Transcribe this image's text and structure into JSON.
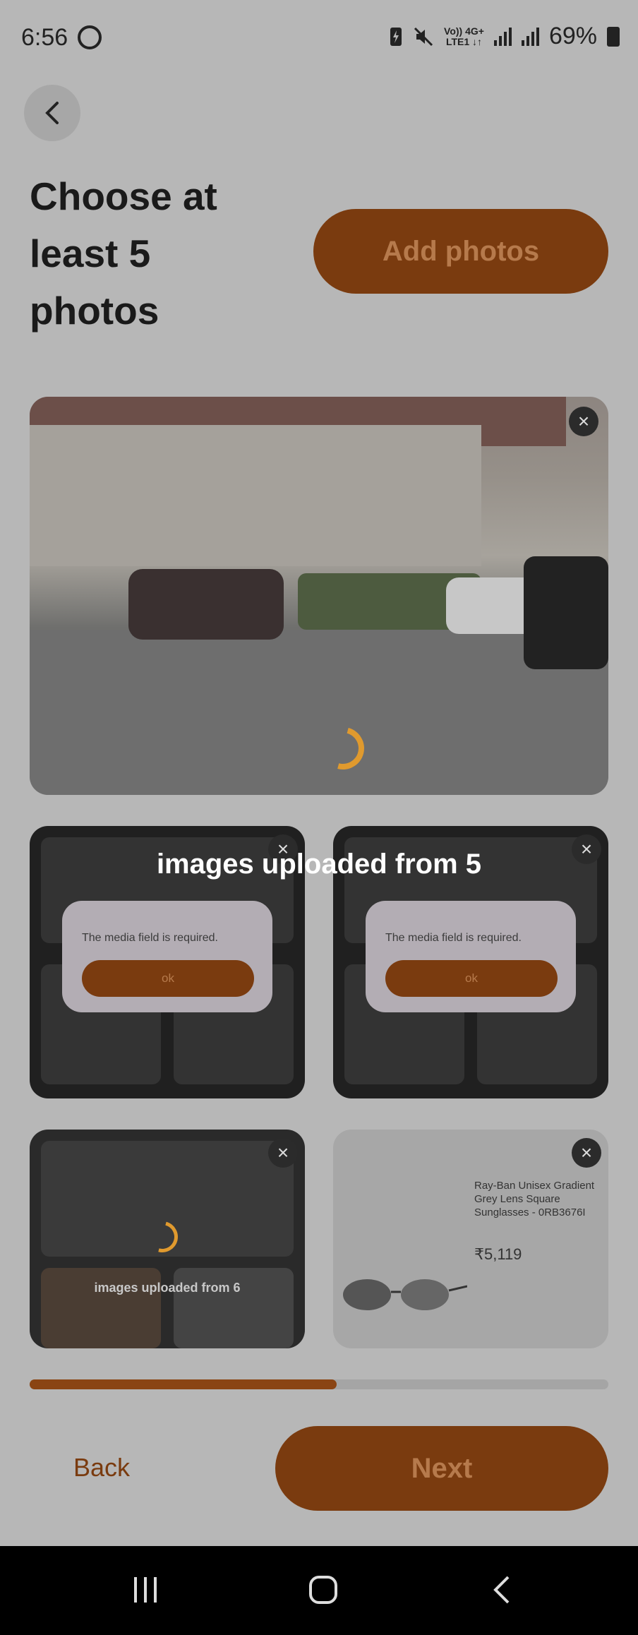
{
  "status_bar": {
    "time": "6:56",
    "network_top": "Vo)) 4G+",
    "network_bottom": "LTE1 ↓↑",
    "battery": "69%"
  },
  "header": {
    "title": "Choose at least  5 photos",
    "add_photos_label": "Add photos"
  },
  "overlay": {
    "uploaded_text": "images uploaded from 5",
    "uploaded_text_2": "images uploaded from 6"
  },
  "dialogs": [
    {
      "message": "The media field is required.",
      "ok_label": "ok"
    },
    {
      "message": "The media field is required.",
      "ok_label": "ok"
    }
  ],
  "screenshot_product": {
    "title": "Ray-Ban Unisex Gradient Grey Lens Square Sunglasses - 0RB3676I",
    "price": "₹5,119"
  },
  "progress": {
    "fraction": 0.53
  },
  "footer": {
    "back_label": "Back",
    "next_label": "Next"
  },
  "colors": {
    "accent": "#7a3b0f",
    "spinner": "#e09a2e"
  },
  "icons": {
    "back": "chevron-left-icon",
    "close": "close-icon",
    "nav_recents": "recents-icon",
    "nav_home": "home-icon",
    "nav_back": "back-icon"
  }
}
